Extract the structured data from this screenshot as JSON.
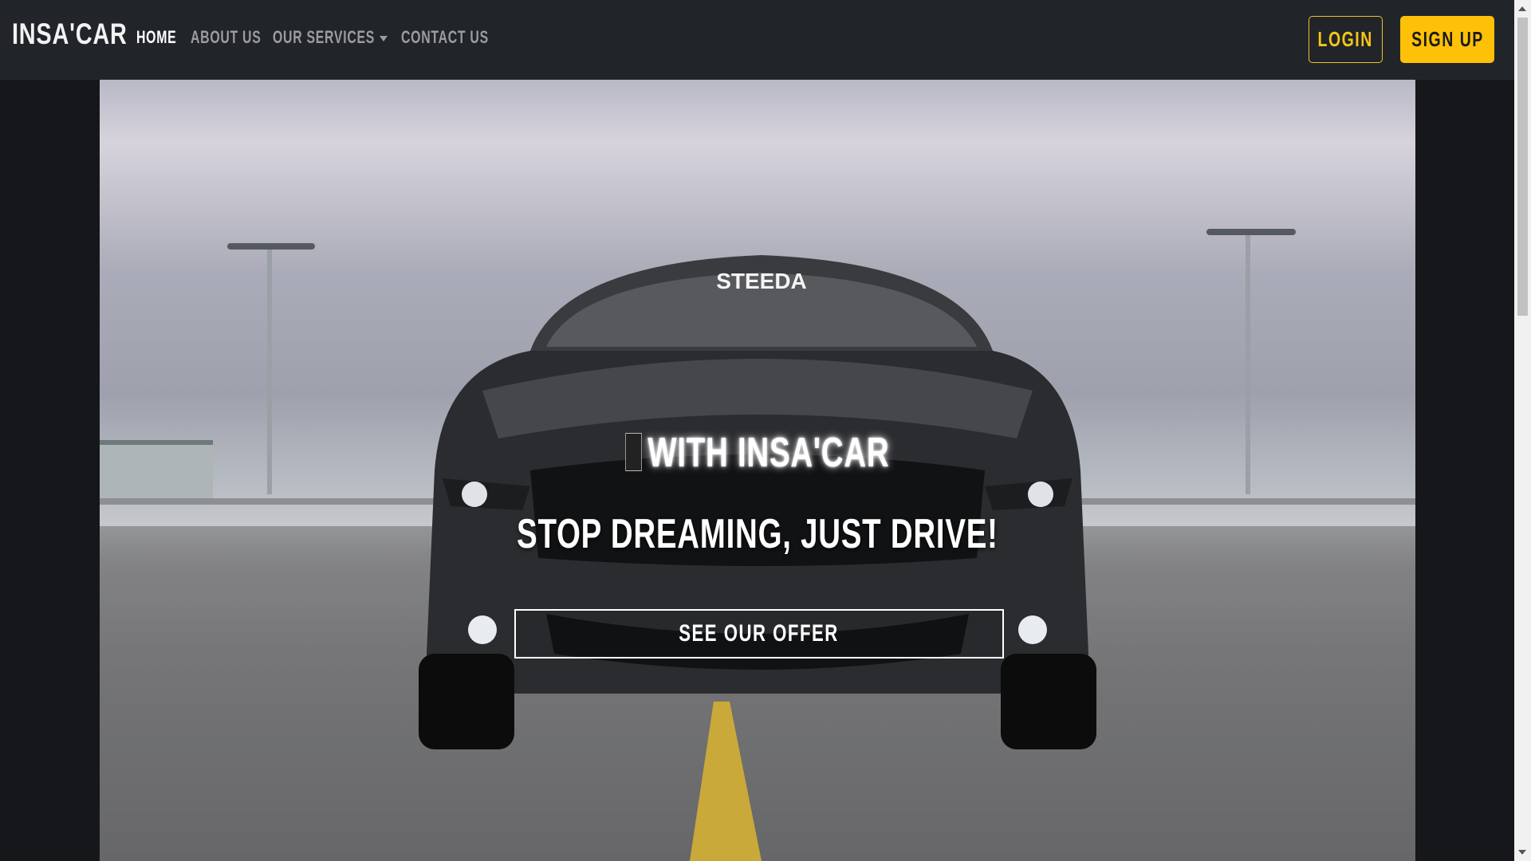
{
  "navbar": {
    "brand": "INSA'CAR",
    "links": [
      {
        "label": "HOME",
        "active": true
      },
      {
        "label": "ABOUT US",
        "active": false
      },
      {
        "label": "OUR SERVICES",
        "active": false,
        "dropdown": true
      },
      {
        "label": "CONTACT US",
        "active": false
      }
    ],
    "login_label": "LOGIN",
    "signup_label": "SIGN UP"
  },
  "hero": {
    "windshield_text": "STEEDA",
    "line1": "WITH INSA'CAR",
    "line2": "STOP DREAMING, JUST DRIVE!",
    "cta_label": "SEE OUR OFFER"
  },
  "colors": {
    "navbar_bg": "#212529",
    "accent": "#ffc107",
    "page_bg": "#16171a"
  },
  "icons": {
    "dropdown": "caret-down-icon",
    "emblem": "car-emblem-icon"
  }
}
